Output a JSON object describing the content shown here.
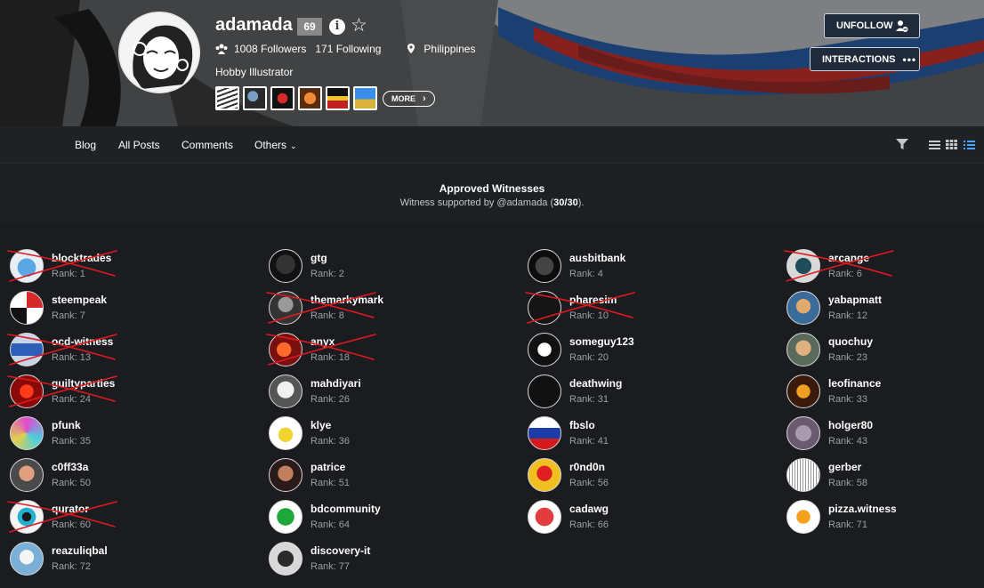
{
  "profile": {
    "username": "adamada",
    "reputation": "69",
    "followers": "1008 Followers",
    "following": "171 Following",
    "location": "Philippines",
    "bio": "Hobby Illustrator",
    "more_label": "MORE",
    "unfollow_label": "UNFOLLOW",
    "interactions_label": "INTERACTIONS",
    "badges": [
      "badge-1",
      "badge-2",
      "badge-3",
      "badge-4",
      "badge-5",
      "badge-6"
    ]
  },
  "nav": {
    "items": [
      "Blog",
      "All Posts",
      "Comments",
      "Others"
    ]
  },
  "witnesses_header": {
    "title": "Approved Witnesses",
    "subtitle_prefix": "Witness supported by @adamada (",
    "subtitle_count": "30/30",
    "subtitle_suffix": ")."
  },
  "colors": {
    "accent": "#4aa3ff",
    "strike": "#e0191e",
    "background": "#1a1c1f"
  },
  "witnesses": [
    {
      "name": "blocktrades",
      "rank": "Rank: 1",
      "struck": true
    },
    {
      "name": "gtg",
      "rank": "Rank: 2",
      "struck": false
    },
    {
      "name": "ausbitbank",
      "rank": "Rank: 4",
      "struck": false
    },
    {
      "name": "arcange",
      "rank": "Rank: 6",
      "struck": true
    },
    {
      "name": "steempeak",
      "rank": "Rank: 7",
      "struck": false
    },
    {
      "name": "themarkymark",
      "rank": "Rank: 8",
      "struck": true
    },
    {
      "name": "pharesim",
      "rank": "Rank: 10",
      "struck": true
    },
    {
      "name": "yabapmatt",
      "rank": "Rank: 12",
      "struck": false
    },
    {
      "name": "ocd-witness",
      "rank": "Rank: 13",
      "struck": true
    },
    {
      "name": "anyx",
      "rank": "Rank: 18",
      "struck": true
    },
    {
      "name": "someguy123",
      "rank": "Rank: 20",
      "struck": false
    },
    {
      "name": "quochuy",
      "rank": "Rank: 23",
      "struck": false
    },
    {
      "name": "guiltyparties",
      "rank": "Rank: 24",
      "struck": true
    },
    {
      "name": "mahdiyari",
      "rank": "Rank: 26",
      "struck": false
    },
    {
      "name": "deathwing",
      "rank": "Rank: 31",
      "struck": false
    },
    {
      "name": "leofinance",
      "rank": "Rank: 33",
      "struck": false
    },
    {
      "name": "pfunk",
      "rank": "Rank: 35",
      "struck": false
    },
    {
      "name": "klye",
      "rank": "Rank: 36",
      "struck": false
    },
    {
      "name": "fbslo",
      "rank": "Rank: 41",
      "struck": false
    },
    {
      "name": "holger80",
      "rank": "Rank: 43",
      "struck": false
    },
    {
      "name": "c0ff33a",
      "rank": "Rank: 50",
      "struck": false
    },
    {
      "name": "patrice",
      "rank": "Rank: 51",
      "struck": false
    },
    {
      "name": "r0nd0n",
      "rank": "Rank: 56",
      "struck": false
    },
    {
      "name": "gerber",
      "rank": "Rank: 58",
      "struck": false
    },
    {
      "name": "qurator",
      "rank": "Rank: 60",
      "struck": true
    },
    {
      "name": "bdcommunity",
      "rank": "Rank: 64",
      "struck": false
    },
    {
      "name": "cadawg",
      "rank": "Rank: 66",
      "struck": false
    },
    {
      "name": "pizza.witness",
      "rank": "Rank: 71",
      "struck": false
    },
    {
      "name": "reazuliqbal",
      "rank": "Rank: 72",
      "struck": false
    },
    {
      "name": "discovery-it",
      "rank": "Rank: 77",
      "struck": false
    }
  ]
}
